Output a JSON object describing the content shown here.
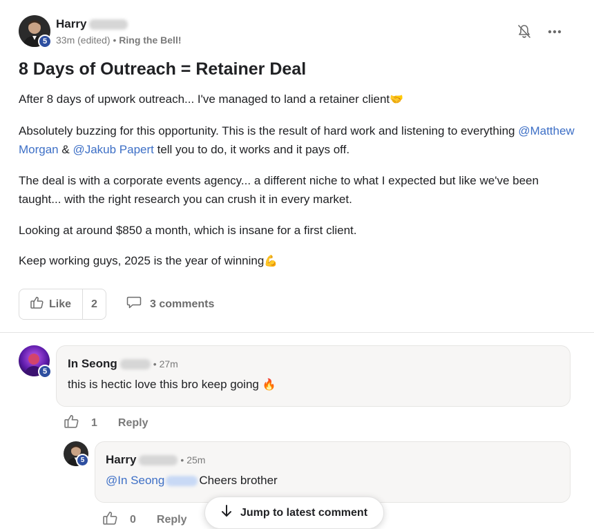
{
  "post": {
    "author": {
      "first_name": "Harry",
      "level": "5"
    },
    "meta": {
      "time": "33m (edited)",
      "separator": " • ",
      "category": "Ring the Bell!"
    },
    "title": "8 Days of Outreach = Retainer Deal",
    "body": {
      "p1": "After 8 days of upwork outreach... I've managed to land a retainer client",
      "p1_emoji": "🤝",
      "p2_start": "Absolutely buzzing for this opportunity. This is the result of hard work and listening to everything ",
      "mention1": "@Matthew Morgan",
      "p2_mid": " & ",
      "mention2": "@Jakub Papert",
      "p2_end": " tell you to do, it works and it pays off.",
      "p3": "The deal is with a corporate events agency... a different niche to what I expected but like we've been taught... with the right research you can crush it in every market.",
      "p4": "Looking at around $850 a month, which is insane for a first client.",
      "p5": "Keep working guys, 2025 is the year of winning",
      "p5_emoji": "💪"
    },
    "like_label": "Like",
    "like_count": "2",
    "comments_label": "3 comments",
    "icons": {
      "bell": "bell-off-icon",
      "more": "more-horizontal-icon",
      "like": "thumbs-up-icon",
      "comment": "comment-icon"
    }
  },
  "comments": [
    {
      "author": "In Seong",
      "level": "5",
      "time": "• 27m",
      "text": "this is hectic love this bro keep going",
      "emoji": "🔥",
      "likes": "1",
      "reply_label": "Reply"
    },
    {
      "author": "Harry",
      "level": "5",
      "time": "• 25m",
      "mention": "@In Seong",
      "text": "Cheers brother",
      "likes": "0",
      "reply_label": "Reply"
    }
  ],
  "jump_button": {
    "label": "Jump to latest comment",
    "icon": "arrow-down-icon"
  },
  "colors": {
    "mention": "#3d6fc6",
    "level_badge": "#2e4fa0",
    "bubble_bg": "#f7f6f5"
  }
}
